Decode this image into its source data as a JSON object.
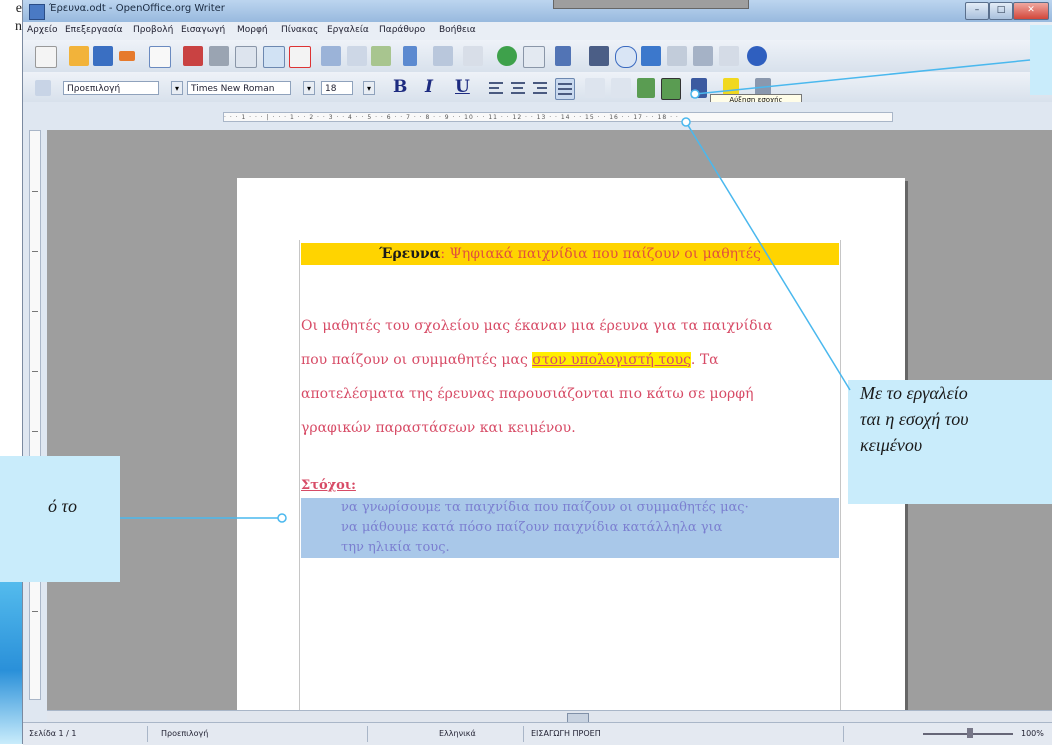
{
  "book": {
    "left_text_lines": [
      "e",
      "n"
    ]
  },
  "window": {
    "title": "Έρευνα.odt - OpenOffice.org Writer",
    "buttons": {
      "minimize": "–",
      "maximize": "□",
      "close": "✕"
    }
  },
  "menu": [
    "Αρχείο",
    "Επεξεργασία",
    "Προβολή",
    "Εισαγωγή",
    "Μορφή",
    "Πίνακας",
    "Εργαλεία",
    "Παράθυρο",
    "Βοήθεια"
  ],
  "toolbar2": {
    "style_value": "Προεπιλογή",
    "font_value": "Times New Roman",
    "size_value": "18",
    "bold_label": "B",
    "italic_label": "I",
    "underline_label": "U"
  },
  "tooltip": "Αύξηση εσοχής",
  "ruler_text": "· · · 1 · · · | · · · 1 · · 2 · · 3 · · 4 · · 5 · · 6 · · 7 · · 8 · · 9 · · 10 · · 11 · · 12 · · 13 · · 14 · · 15 · · 16 · · 17 · · 18 · ·",
  "document": {
    "heading_bold": "Έρευνα",
    "heading_rest": ": Ψηφιακά παιχνίδια που παίζουν οι μαθητές",
    "paragraph": {
      "line1": "Οι μαθητές του σχολείου μας έκαναν μια έρευνα για τα παιχνίδια",
      "line2_before": "που παίζουν οι συμμαθητές μας ",
      "line2_highlight": "στον υπολογιστή τους",
      "line2_after": ". Τα",
      "line3": "αποτελέσματα της έρευνας παρουσιάζονται πιο κάτω σε μορφή",
      "line4": "γραφικών παραστάσεων και κειμένου."
    },
    "goals_label": "Στόχοι:",
    "goals": [
      "να γνωρίσουμε τα παιχνίδια που παίζουν οι συμμαθητές μας·",
      "να μάθουμε κατά πόσο παίζουν παιχνίδια κατάλληλα για",
      "την ηλικία τους."
    ]
  },
  "statusbar": {
    "page": "Σελίδα 1 / 1",
    "style": "Προεπιλογή",
    "language": "Ελληνικά",
    "mode": "ΕΙΣΑΓΩΓΗ  ΠΡΟΕΠ",
    "zoom": "100%"
  },
  "callouts": {
    "right": [
      "Με το εργαλείο",
      "ται η εσοχή του",
      "κειμένου"
    ],
    "left": "ό το"
  }
}
